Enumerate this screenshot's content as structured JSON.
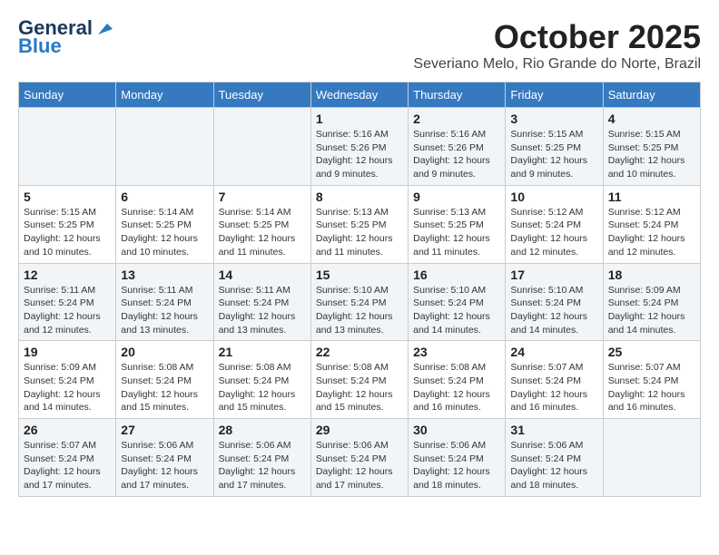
{
  "header": {
    "logo_line1": "General",
    "logo_line2": "Blue",
    "month": "October 2025",
    "location": "Severiano Melo, Rio Grande do Norte, Brazil"
  },
  "days_of_week": [
    "Sunday",
    "Monday",
    "Tuesday",
    "Wednesday",
    "Thursday",
    "Friday",
    "Saturday"
  ],
  "weeks": [
    [
      {
        "day": "",
        "info": ""
      },
      {
        "day": "",
        "info": ""
      },
      {
        "day": "",
        "info": ""
      },
      {
        "day": "1",
        "info": "Sunrise: 5:16 AM\nSunset: 5:26 PM\nDaylight: 12 hours\nand 9 minutes."
      },
      {
        "day": "2",
        "info": "Sunrise: 5:16 AM\nSunset: 5:26 PM\nDaylight: 12 hours\nand 9 minutes."
      },
      {
        "day": "3",
        "info": "Sunrise: 5:15 AM\nSunset: 5:25 PM\nDaylight: 12 hours\nand 9 minutes."
      },
      {
        "day": "4",
        "info": "Sunrise: 5:15 AM\nSunset: 5:25 PM\nDaylight: 12 hours\nand 10 minutes."
      }
    ],
    [
      {
        "day": "5",
        "info": "Sunrise: 5:15 AM\nSunset: 5:25 PM\nDaylight: 12 hours\nand 10 minutes."
      },
      {
        "day": "6",
        "info": "Sunrise: 5:14 AM\nSunset: 5:25 PM\nDaylight: 12 hours\nand 10 minutes."
      },
      {
        "day": "7",
        "info": "Sunrise: 5:14 AM\nSunset: 5:25 PM\nDaylight: 12 hours\nand 11 minutes."
      },
      {
        "day": "8",
        "info": "Sunrise: 5:13 AM\nSunset: 5:25 PM\nDaylight: 12 hours\nand 11 minutes."
      },
      {
        "day": "9",
        "info": "Sunrise: 5:13 AM\nSunset: 5:25 PM\nDaylight: 12 hours\nand 11 minutes."
      },
      {
        "day": "10",
        "info": "Sunrise: 5:12 AM\nSunset: 5:24 PM\nDaylight: 12 hours\nand 12 minutes."
      },
      {
        "day": "11",
        "info": "Sunrise: 5:12 AM\nSunset: 5:24 PM\nDaylight: 12 hours\nand 12 minutes."
      }
    ],
    [
      {
        "day": "12",
        "info": "Sunrise: 5:11 AM\nSunset: 5:24 PM\nDaylight: 12 hours\nand 12 minutes."
      },
      {
        "day": "13",
        "info": "Sunrise: 5:11 AM\nSunset: 5:24 PM\nDaylight: 12 hours\nand 13 minutes."
      },
      {
        "day": "14",
        "info": "Sunrise: 5:11 AM\nSunset: 5:24 PM\nDaylight: 12 hours\nand 13 minutes."
      },
      {
        "day": "15",
        "info": "Sunrise: 5:10 AM\nSunset: 5:24 PM\nDaylight: 12 hours\nand 13 minutes."
      },
      {
        "day": "16",
        "info": "Sunrise: 5:10 AM\nSunset: 5:24 PM\nDaylight: 12 hours\nand 14 minutes."
      },
      {
        "day": "17",
        "info": "Sunrise: 5:10 AM\nSunset: 5:24 PM\nDaylight: 12 hours\nand 14 minutes."
      },
      {
        "day": "18",
        "info": "Sunrise: 5:09 AM\nSunset: 5:24 PM\nDaylight: 12 hours\nand 14 minutes."
      }
    ],
    [
      {
        "day": "19",
        "info": "Sunrise: 5:09 AM\nSunset: 5:24 PM\nDaylight: 12 hours\nand 14 minutes."
      },
      {
        "day": "20",
        "info": "Sunrise: 5:08 AM\nSunset: 5:24 PM\nDaylight: 12 hours\nand 15 minutes."
      },
      {
        "day": "21",
        "info": "Sunrise: 5:08 AM\nSunset: 5:24 PM\nDaylight: 12 hours\nand 15 minutes."
      },
      {
        "day": "22",
        "info": "Sunrise: 5:08 AM\nSunset: 5:24 PM\nDaylight: 12 hours\nand 15 minutes."
      },
      {
        "day": "23",
        "info": "Sunrise: 5:08 AM\nSunset: 5:24 PM\nDaylight: 12 hours\nand 16 minutes."
      },
      {
        "day": "24",
        "info": "Sunrise: 5:07 AM\nSunset: 5:24 PM\nDaylight: 12 hours\nand 16 minutes."
      },
      {
        "day": "25",
        "info": "Sunrise: 5:07 AM\nSunset: 5:24 PM\nDaylight: 12 hours\nand 16 minutes."
      }
    ],
    [
      {
        "day": "26",
        "info": "Sunrise: 5:07 AM\nSunset: 5:24 PM\nDaylight: 12 hours\nand 17 minutes."
      },
      {
        "day": "27",
        "info": "Sunrise: 5:06 AM\nSunset: 5:24 PM\nDaylight: 12 hours\nand 17 minutes."
      },
      {
        "day": "28",
        "info": "Sunrise: 5:06 AM\nSunset: 5:24 PM\nDaylight: 12 hours\nand 17 minutes."
      },
      {
        "day": "29",
        "info": "Sunrise: 5:06 AM\nSunset: 5:24 PM\nDaylight: 12 hours\nand 17 minutes."
      },
      {
        "day": "30",
        "info": "Sunrise: 5:06 AM\nSunset: 5:24 PM\nDaylight: 12 hours\nand 18 minutes."
      },
      {
        "day": "31",
        "info": "Sunrise: 5:06 AM\nSunset: 5:24 PM\nDaylight: 12 hours\nand 18 minutes."
      },
      {
        "day": "",
        "info": ""
      }
    ]
  ]
}
